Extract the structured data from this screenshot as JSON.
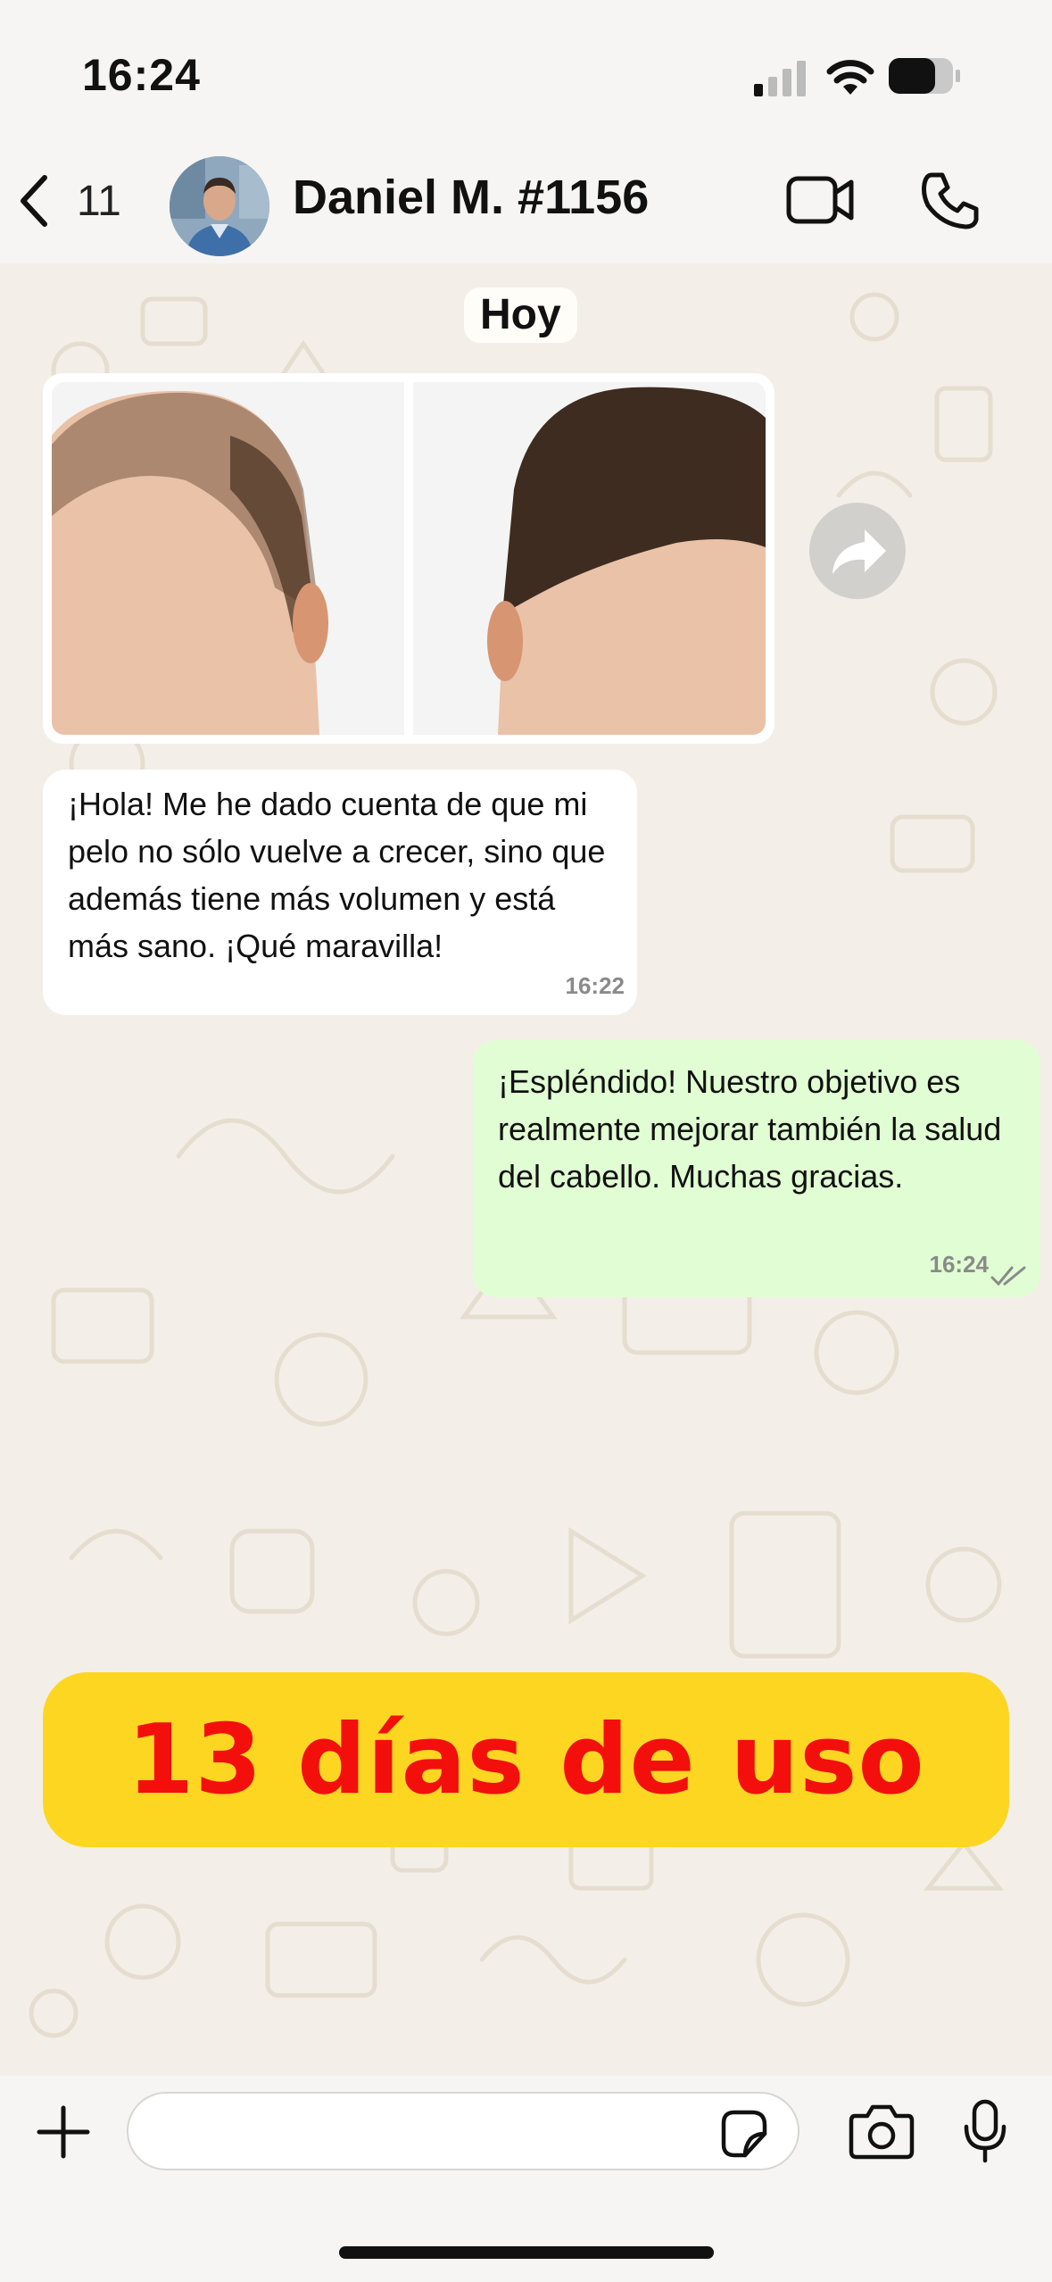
{
  "status_bar": {
    "time": "16:24"
  },
  "header": {
    "back_count": "11",
    "contact_name": "Daniel M. #1156"
  },
  "chat": {
    "date_label": "Hoy",
    "incoming": {
      "text": "¡Hola! Me he dado cuenta de que mi pelo no sólo vuelve a crecer, sino que además tiene más volumen y está más sano. ¡Qué maravilla!",
      "time": "16:22"
    },
    "outgoing": {
      "text": "¡Espléndido! Nuestro objetivo es realmente mejorar también la salud del cabello. Muchas gracias.",
      "time": "16:24"
    }
  },
  "banner": {
    "text": "13 días de uso",
    "background": "#fdd622",
    "text_color": "#f20f0c"
  },
  "composer": {
    "placeholder": ""
  },
  "colors": {
    "outgoing_bubble": "#e1fdd3",
    "incoming_bubble": "#ffffff",
    "wallpaper": "#f3efe8"
  }
}
